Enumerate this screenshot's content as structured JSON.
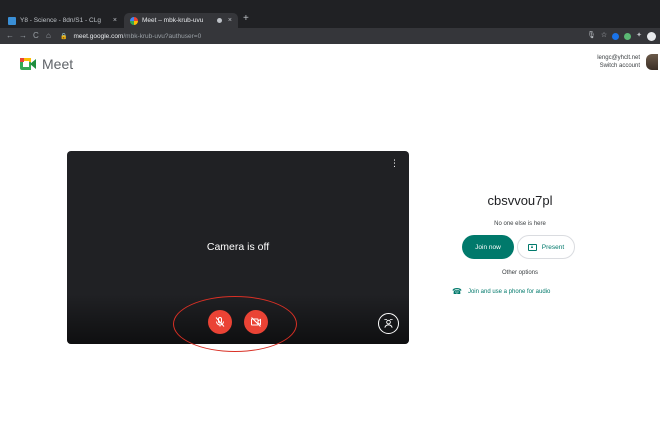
{
  "browser": {
    "tabs": [
      {
        "title": "Y8 - Science - 8dn/S1 - CLg",
        "close": "×",
        "active": false
      },
      {
        "title": "Meet – mbk-krub-uvu",
        "close": "×",
        "active": true
      }
    ],
    "new_tab": "+",
    "nav": {
      "back": "←",
      "forward": "→",
      "reload": "C",
      "home": "⌂"
    },
    "url": {
      "lock": "🔒",
      "host": "meet.google.com",
      "path": "/mbk-krub-uvu?authuser=0"
    },
    "toolbar_icons": {
      "mic": "🎙",
      "star": "☆",
      "extensions": "✦"
    }
  },
  "header": {
    "product_name": "Meet",
    "account_email": "lengc@yhclt.net",
    "switch_account": "Switch account"
  },
  "preview": {
    "camera_status": "Camera is off",
    "more_icon": "⋮",
    "mic_state": "off",
    "camera_state": "off"
  },
  "join_panel": {
    "meeting_code": "cbsvvou7pl",
    "status": "No one else is here",
    "join_label": "Join now",
    "present_label": "Present",
    "other_options": "Other options",
    "phone_audio": "Join and use a phone for audio"
  },
  "colors": {
    "accent": "#00796b",
    "danger": "#ea4335",
    "preview_bg": "#202124",
    "annotation": "#d93025"
  }
}
